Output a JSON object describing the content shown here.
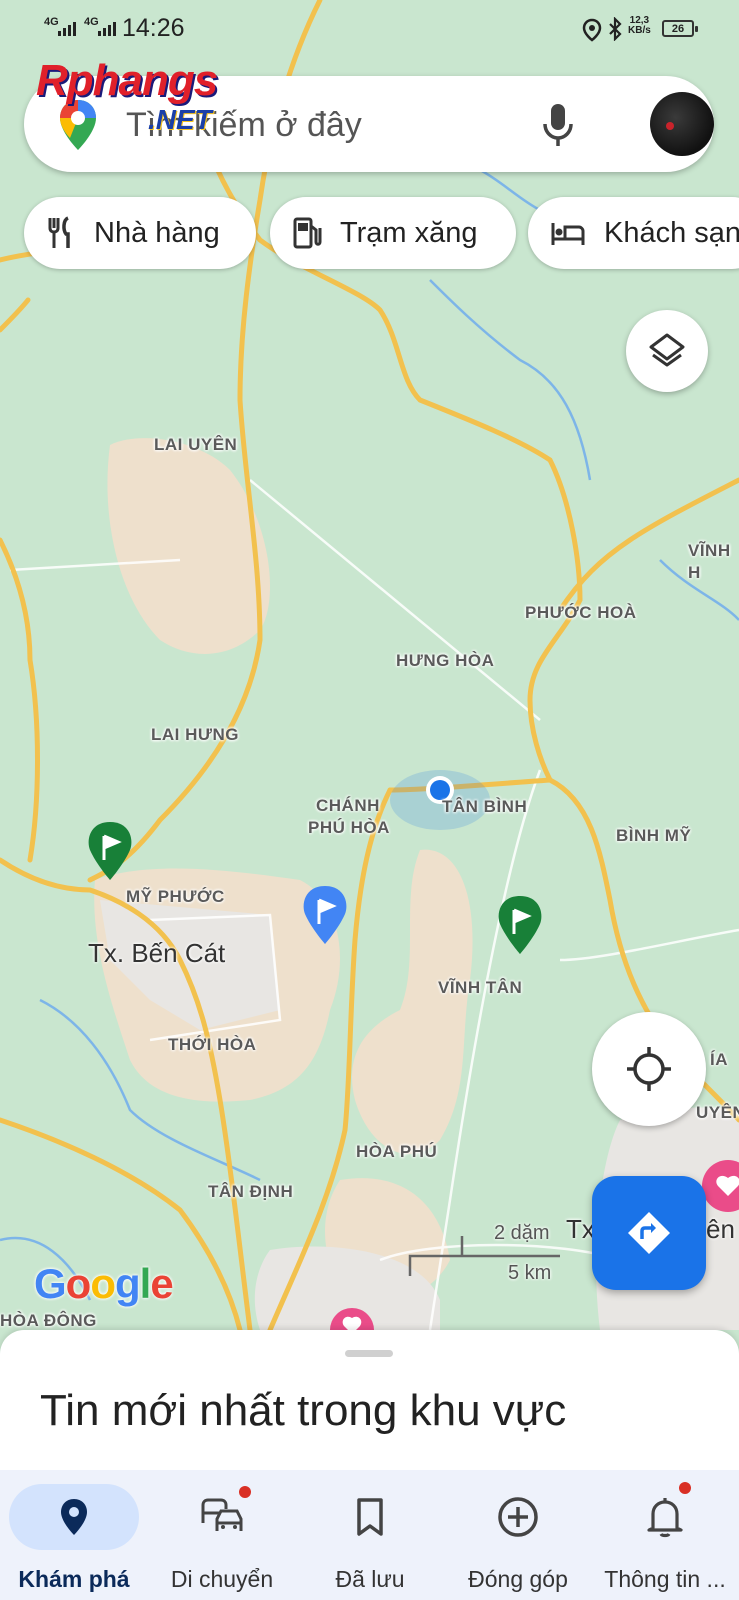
{
  "status_bar": {
    "signal_1": "4G",
    "signal_2": "4G",
    "time": "14:26",
    "net_speed_value": "12,3",
    "net_speed_unit": "KB/s",
    "battery": "26",
    "icons": [
      "location-icon",
      "bluetooth-icon"
    ]
  },
  "search": {
    "placeholder": "Tìm kiếm ở đây",
    "watermark_brand": "Rphangs",
    "watermark_suffix": ".NET"
  },
  "chips": [
    {
      "label": "Nhà hàng",
      "icon": "restaurant-icon"
    },
    {
      "label": "Trạm xăng",
      "icon": "gas-station-icon"
    },
    {
      "label": "Khách sạn",
      "icon": "hotel-icon"
    }
  ],
  "map": {
    "labels": {
      "lai_uyen": "LAI UYÊN",
      "vinh_h": "VĨNH H",
      "phuoc_hoa": "PHƯỚC HOÀ",
      "hung_hoa": "HƯNG HÒA",
      "lai_hung": "LAI HƯNG",
      "chanh_1": "CHÁNH",
      "chanh_2": "PHÚ HÒA",
      "tan_binh": "TÂN BÌNH",
      "binh_my": "BÌNH MỸ",
      "my_phuoc": "MỸ PHƯỚC",
      "ben_cat": "Tx. Bến Cát",
      "vinh_tan": "VĨNH TÂN",
      "thoi_hoa": "THỚI HÒA",
      "hoa_phu": "HÒA PHÚ",
      "tan_dinh": "TÂN ĐỊNH",
      "hoa_dong": "HÒA ĐÔNG",
      "ia": "ÍA",
      "uyen": "UYÊN",
      "tx_right": "Tx",
      "en_right": "ên"
    },
    "google_logo": "Google",
    "scale_miles": "2 dặm",
    "scale_km": "5 km",
    "colors": {
      "land": "#c9e6cf",
      "urban": "#eee0cc",
      "road": "#f2c14e",
      "water": "#7db5e8",
      "location_dot": "#1a73e8",
      "accent": "#1a73e8"
    }
  },
  "buttons": {
    "layers": "layers-icon",
    "my_location": "crosshair-icon",
    "directions": "directions-icon"
  },
  "sheet": {
    "title": "Tin mới nhất trong khu vực"
  },
  "bottom_nav": [
    {
      "label": "Khám phá",
      "icon": "explore-pin-icon",
      "active": true,
      "badge": false
    },
    {
      "label": "Di chuyển",
      "icon": "commute-icon",
      "active": false,
      "badge": true
    },
    {
      "label": "Đã lưu",
      "icon": "bookmark-icon",
      "active": false,
      "badge": false
    },
    {
      "label": "Đóng góp",
      "icon": "add-circle-icon",
      "active": false,
      "badge": false
    },
    {
      "label": "Thông tin ...",
      "icon": "bell-icon",
      "active": false,
      "badge": true
    }
  ]
}
